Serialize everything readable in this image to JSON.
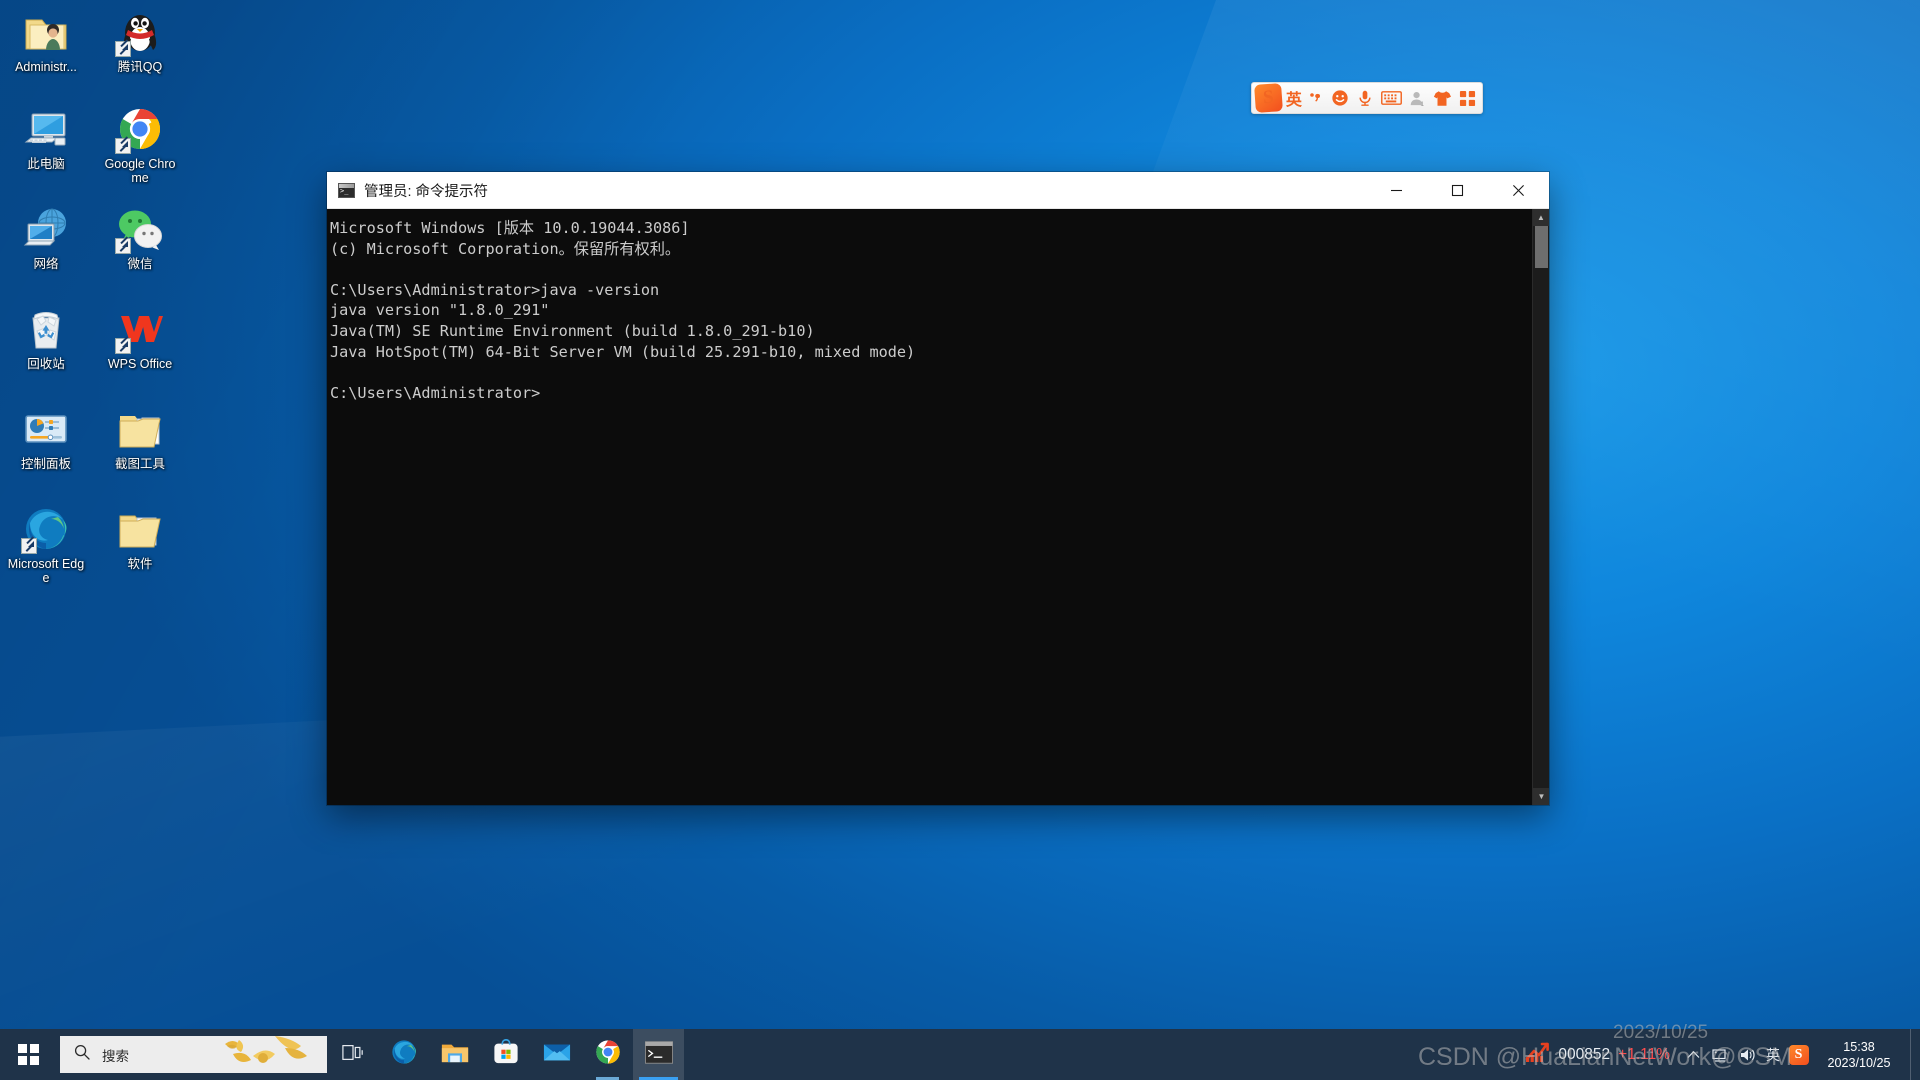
{
  "desktop": {
    "icons": [
      {
        "label": "Administr...",
        "icon": "user-folder-icon",
        "shortcut": false
      },
      {
        "label": "腾讯QQ",
        "icon": "qq-penguin-icon",
        "shortcut": true
      },
      {
        "label": "此电脑",
        "icon": "this-pc-icon",
        "shortcut": false
      },
      {
        "label": "Google Chrome",
        "icon": "chrome-icon",
        "shortcut": true
      },
      {
        "label": "网络",
        "icon": "network-icon",
        "shortcut": false
      },
      {
        "label": "微信",
        "icon": "wechat-icon",
        "shortcut": true
      },
      {
        "label": "回收站",
        "icon": "recycle-bin-icon",
        "shortcut": false
      },
      {
        "label": "WPS Office",
        "icon": "wps-office-icon",
        "shortcut": true
      },
      {
        "label": "控制面板",
        "icon": "control-panel-icon",
        "shortcut": false
      },
      {
        "label": "截图工具",
        "icon": "snipping-tool-folder-icon",
        "shortcut": false
      },
      {
        "label": "Microsoft Edge",
        "icon": "edge-icon",
        "shortcut": true
      },
      {
        "label": "软件",
        "icon": "software-folder-icon",
        "shortcut": false
      }
    ]
  },
  "ime_bar": {
    "logo_label": "S",
    "mode_label": "英",
    "items": [
      {
        "name": "sogou-logo-icon",
        "label": "S"
      },
      {
        "name": "ime-mode-english-icon",
        "label": "英"
      },
      {
        "name": "ime-punctuation-icon",
        "label": "·,"
      },
      {
        "name": "ime-emoji-icon",
        "label": "☺"
      },
      {
        "name": "ime-voice-input-icon",
        "label": "🎤"
      },
      {
        "name": "ime-soft-keyboard-icon",
        "label": "⌨"
      },
      {
        "name": "ime-user-icon",
        "label": "👤"
      },
      {
        "name": "ime-skin-icon",
        "label": "👕"
      },
      {
        "name": "ime-toolbox-icon",
        "label": "⠿"
      }
    ]
  },
  "cmd_window": {
    "title": "管理员: 命令提示符",
    "icon": "cmd-icon",
    "controls": {
      "minimize": "最小化",
      "maximize": "最大化",
      "close": "关闭"
    },
    "terminal_text": "Microsoft Windows [版本 10.0.19044.3086]\n(c) Microsoft Corporation。保留所有权利。\n\nC:\\Users\\Administrator>java -version\njava version \"1.8.0_291\"\nJava(TM) SE Runtime Environment (build 1.8.0_291-b10)\nJava HotSpot(TM) 64-Bit Server VM (build 25.291-b10, mixed mode)\n\nC:\\Users\\Administrator>",
    "terminal_lines": [
      "Microsoft Windows [版本 10.0.19044.3086]",
      "(c) Microsoft Corporation。保留所有权利。",
      "",
      "C:\\Users\\Administrator>java -version",
      "java version \"1.8.0_291\"",
      "Java(TM) SE Runtime Environment (build 1.8.0_291-b10)",
      "Java HotSpot(TM) 64-Bit Server VM (build 25.291-b10, mixed mode)",
      "",
      "C:\\Users\\Administrator>"
    ]
  },
  "taskbar": {
    "start_label": "开始",
    "search": {
      "placeholder": "搜索",
      "value": "",
      "icon": "search-icon"
    },
    "apps": [
      {
        "name": "task-view-icon",
        "label": "任务视图",
        "state": "idle"
      },
      {
        "name": "edge-icon",
        "label": "Microsoft Edge",
        "state": "idle"
      },
      {
        "name": "file-explorer-icon",
        "label": "文件资源管理器",
        "state": "idle"
      },
      {
        "name": "microsoft-store-icon",
        "label": "Microsoft Store",
        "state": "idle"
      },
      {
        "name": "mail-icon",
        "label": "邮件",
        "state": "idle"
      },
      {
        "name": "chrome-icon",
        "label": "Google Chrome",
        "state": "running"
      },
      {
        "name": "command-prompt-icon",
        "label": "命令提示符",
        "state": "active"
      }
    ],
    "tray": {
      "stock": {
        "icon": "stock-chart-icon",
        "code": "000852",
        "change": "+1.11%",
        "change_color": "#ff4d4d"
      },
      "chevron_icon": "chevron-up-icon",
      "icons": [
        {
          "name": "network-tray-icon",
          "label": "网络"
        },
        {
          "name": "volume-tray-icon",
          "label": "音量"
        }
      ],
      "ime_mode": "英",
      "sogou_label": "S",
      "clock": {
        "time": "15:38",
        "date": "2023/10/25"
      },
      "show_desktop": "显示桌面"
    }
  },
  "watermarks": {
    "line1": "CSDN @HuaLianNetWork@CSM",
    "line2": "2023/10/25"
  },
  "colors": {
    "desktop_blue": "#0f86dc",
    "taskbar": "#1f3349",
    "terminal_bg": "#0c0c0c",
    "terminal_fg": "#cccccc",
    "accent_blue": "#3aa0f2",
    "sogou_orange": "#f26522",
    "stock_red": "#ff4d4d"
  }
}
